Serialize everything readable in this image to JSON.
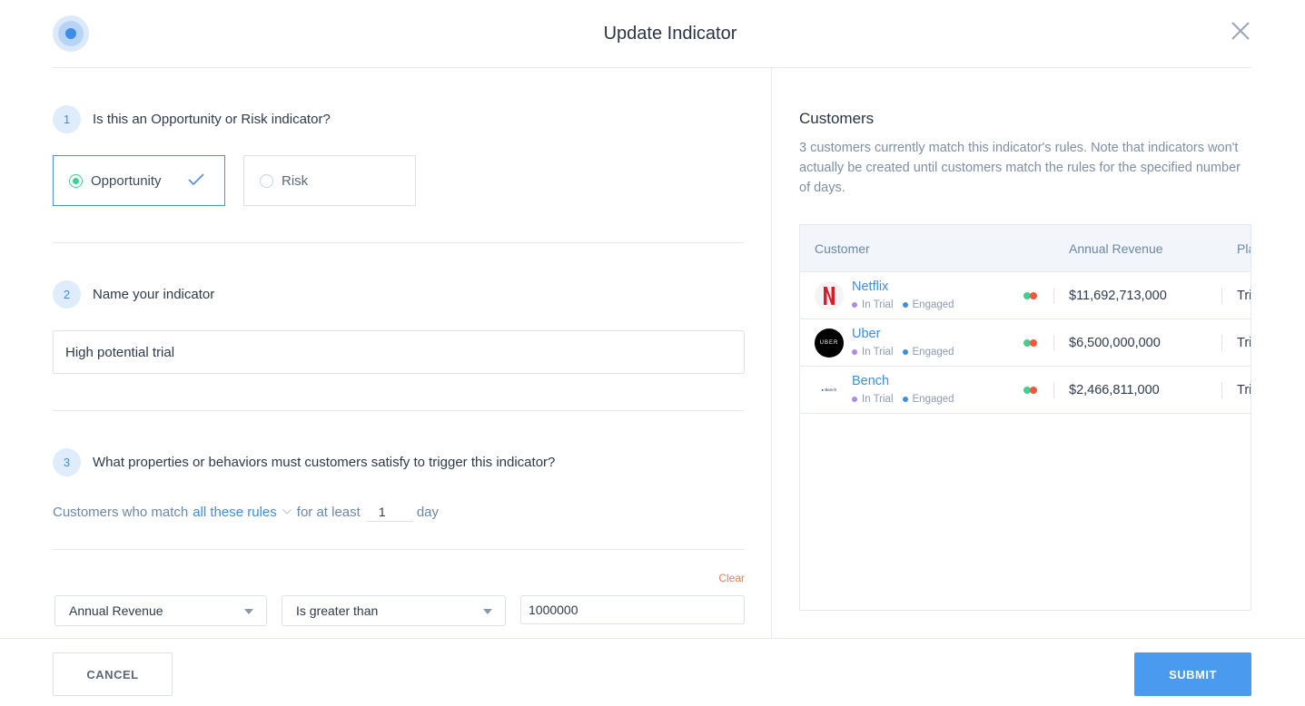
{
  "header": {
    "title": "Update Indicator"
  },
  "step1": {
    "number": "1",
    "question": "Is this an Opportunity or Risk indicator?",
    "options": [
      {
        "label": "Opportunity",
        "selected": true
      },
      {
        "label": "Risk",
        "selected": false
      }
    ]
  },
  "step2": {
    "number": "2",
    "question": "Name your indicator",
    "value": "High potential trial"
  },
  "step3": {
    "number": "3",
    "question": "What properties or behaviors must customers satisfy to trigger this indicator?",
    "match_prefix": "Customers who match",
    "match_mode": "all these rules",
    "for_at_least": "for at least",
    "days_value": "1",
    "days_unit": "day",
    "clear_label": "Clear",
    "rule": {
      "property": "Annual Revenue",
      "operator": "Is greater than",
      "value": "1000000"
    }
  },
  "customers": {
    "title": "Customers",
    "description": "3 customers currently match this indicator's rules. Note that indicators won't actually be created until customers match the rules for the specified number of days.",
    "columns": [
      "Customer",
      "Annual Revenue",
      "Pla"
    ],
    "rows": [
      {
        "name": "Netflix",
        "tag1": "In Trial",
        "tag2": "Engaged",
        "revenue": "$11,692,713,000",
        "plan": "Tri",
        "logo": "netflix-logo"
      },
      {
        "name": "Uber",
        "tag1": "In Trial",
        "tag2": "Engaged",
        "revenue": "$6,500,000,000",
        "plan": "Tri",
        "logo_text": "UBER"
      },
      {
        "name": "Bench",
        "tag1": "In Trial",
        "tag2": "Engaged",
        "revenue": "$2,466,811,000",
        "plan": "Tri",
        "logo_text": "Bench"
      }
    ]
  },
  "footer": {
    "cancel_label": "CANCEL",
    "submit_label": "SUBMIT"
  },
  "colors": {
    "accent": "#3d8de8",
    "success": "#3fcf8e",
    "danger": "#f05a3a",
    "tag_purple": "#a98ce6"
  }
}
